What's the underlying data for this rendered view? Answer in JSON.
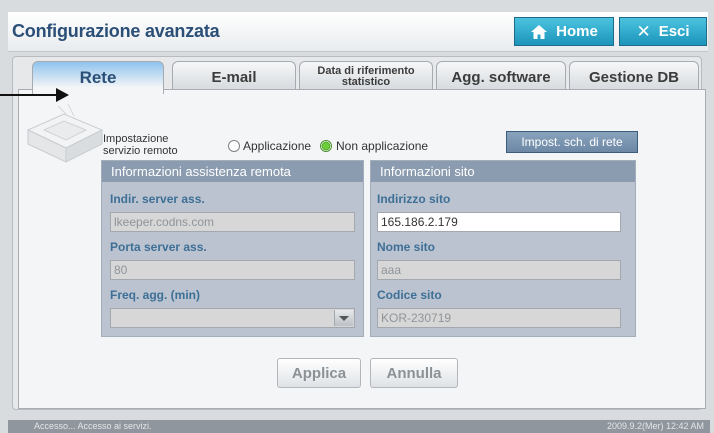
{
  "window": {
    "title": "Configurazione avanzata"
  },
  "topbar": {
    "home_label": "Home",
    "exit_label": "Esci"
  },
  "tabs": [
    {
      "label": "Rete",
      "active": true
    },
    {
      "label": "E-mail",
      "active": false
    },
    {
      "label": "Data di riferimento\nstatistico",
      "active": false
    },
    {
      "label": "Agg. software",
      "active": false
    },
    {
      "label": "Gestione DB",
      "active": false
    }
  ],
  "remote_service": {
    "label": "Impostazione\nservizio remoto",
    "option_apply": "Applicazione",
    "option_not_apply": "Non applicazione",
    "selected": "Non applicazione",
    "schedule_button": "Impost. sch. di rete"
  },
  "assistance": {
    "header": "Informazioni assistenza remota",
    "server_addr_label": "Indir. server ass.",
    "server_addr_value": "lkeeper.codns.com",
    "server_port_label": "Porta server ass.",
    "server_port_value": "80",
    "freq_label": "Freq. agg. (min)",
    "freq_value": ""
  },
  "site": {
    "header": "Informazioni sito",
    "address_label": "Indirizzo sito",
    "address_value": "165.186.2.179",
    "name_label": "Nome sito",
    "name_value": "aaa",
    "code_label": "Codice sito",
    "code_value": "KOR-230719"
  },
  "actions": {
    "apply_label": "Applica",
    "cancel_label": "Annulla"
  },
  "status": {
    "left": "Accesso... Accesso ai servizi.",
    "right": "2009.9.2(Mer)  12:42 AM"
  },
  "colors": {
    "accent": "#1c94bb",
    "title": "#2b4f77",
    "box_header": "#8b9cb0"
  }
}
